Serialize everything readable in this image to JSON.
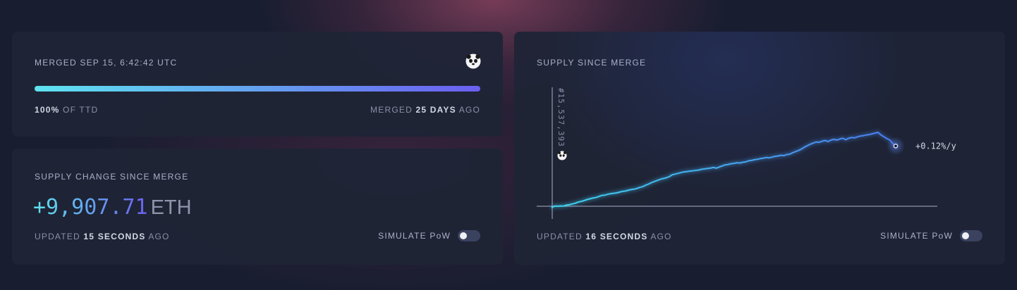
{
  "merge": {
    "title": "MERGED SEP 15, 6:42:42 UTC",
    "ttd_percent": "100%",
    "ttd_suffix": "OF TTD",
    "ttd_progress": 1.0,
    "merged_prefix": "MERGED",
    "merged_days": "25 DAYS",
    "merged_suffix": "AGO",
    "icon": "panda-icon"
  },
  "supply": {
    "title": "SUPPLY CHANGE SINCE MERGE",
    "value": "+9,907.71",
    "unit": "ETH",
    "updated_prefix": "UPDATED",
    "updated_time": "15 SECONDS",
    "updated_suffix": "AGO",
    "simulate_label": "SIMULATE ",
    "simulate_pow": "PoW",
    "simulate_on": false
  },
  "chart": {
    "title": "SUPPLY SINCE MERGE",
    "block_label": "#15,537,393",
    "rate_label": "+0.12%/y",
    "updated_prefix": "UPDATED",
    "updated_time": "16 SECONDS",
    "updated_suffix": "AGO",
    "simulate_label": "SIMULATE ",
    "simulate_pow": "PoW",
    "simulate_on": false,
    "marker_icon": "panda-icon"
  },
  "colors": {
    "accent_start": "#5ee3f0",
    "accent_end": "#6b5ff0",
    "line_start": "#3fd6f0",
    "line_end": "#4a7df0"
  },
  "chart_data": {
    "type": "line",
    "title": "SUPPLY SINCE MERGE",
    "xlabel": "",
    "ylabel": "",
    "grid": false,
    "series": [
      {
        "values": [
          -0.4,
          0.05,
          0,
          0.08,
          0.03,
          0.3,
          0.4,
          0.6,
          0.8,
          1.1,
          1.3,
          1.5,
          1.8,
          2.0,
          2.2,
          2.35,
          2.6,
          2.9,
          3.0,
          3.2,
          3.4,
          3.5,
          3.6,
          3.8,
          4.0,
          4.1,
          4.3,
          4.5,
          4.6,
          4.8,
          5.1,
          5.3,
          5.7,
          6.0,
          6.4,
          6.7,
          7.0,
          7.3,
          7.5,
          7.7,
          8.0,
          8.5,
          8.7,
          8.9,
          9.1,
          9.3,
          9.4,
          9.5,
          9.6,
          9.7,
          9.8,
          10.0,
          10.1,
          10.2,
          10.3,
          10.5,
          10.3,
          10.6,
          10.9,
          11.2,
          11.3,
          11.5,
          11.6,
          11.8,
          11.7,
          11.9,
          12.0,
          12.3,
          12.4,
          12.6,
          12.7,
          12.9,
          13.0,
          13.2,
          13.1,
          13.3,
          13.5,
          13.6,
          13.8,
          13.7,
          14.0,
          14.1,
          14.5,
          14.8,
          15.1,
          15.5,
          16.0,
          16.4,
          16.8,
          17.1,
          17.4,
          17.3,
          17.6,
          17.8,
          17.5,
          17.9,
          18.1,
          17.9,
          18.2,
          18.4,
          18.0,
          18.4,
          18.6,
          18.5,
          18.8,
          19.0,
          19.1,
          19.3,
          19.4,
          19.6,
          19.8,
          20.0,
          19.3,
          18.8,
          18.3,
          17.9,
          17.0,
          16.3
        ]
      }
    ]
  }
}
